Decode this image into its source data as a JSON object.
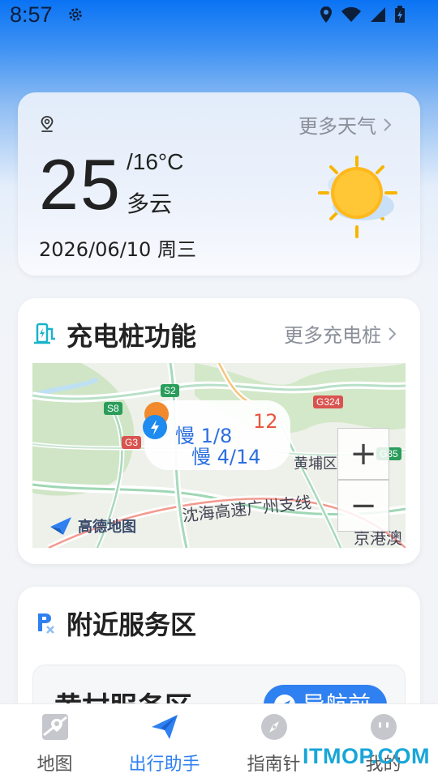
{
  "status_bar": {
    "time": "8:57"
  },
  "weather": {
    "more_label": "更多天气",
    "temperature": "25",
    "low_temperature": "/16°C",
    "condition": "多云",
    "date": "2026/06/10 周三",
    "icon": "partly-cloudy-sun-icon"
  },
  "charging": {
    "title": "充电桩功能",
    "more_label": "更多充电桩",
    "map": {
      "popup_line_1": "慢 1/8",
      "popup_line_2": "慢 4/14",
      "popup_fragment": "12",
      "district_label": "黄埔区",
      "highway_label": "沈海高速广州支线",
      "highway_label_2": "京港澳",
      "badges": [
        "S2",
        "S8",
        "G324",
        "G3",
        "G35"
      ],
      "logo_text": "高德地图",
      "zoom_in": "+",
      "zoom_out": "−"
    }
  },
  "service": {
    "title": "附近服务区",
    "item_name": "黄村服务区",
    "navigate_label": "导航前"
  },
  "bottom_nav": {
    "items": [
      {
        "label": "地图",
        "icon": "map-icon"
      },
      {
        "label": "出行助手",
        "icon": "paper-plane-icon"
      },
      {
        "label": "指南针",
        "icon": "compass-icon"
      },
      {
        "label": "我的",
        "icon": "profile-icon"
      }
    ]
  },
  "watermark": "ITMOP.COM",
  "colors": {
    "accent": "#2f80f0",
    "top_blue": "#0a73f4",
    "muted_text": "#8a8f99"
  }
}
